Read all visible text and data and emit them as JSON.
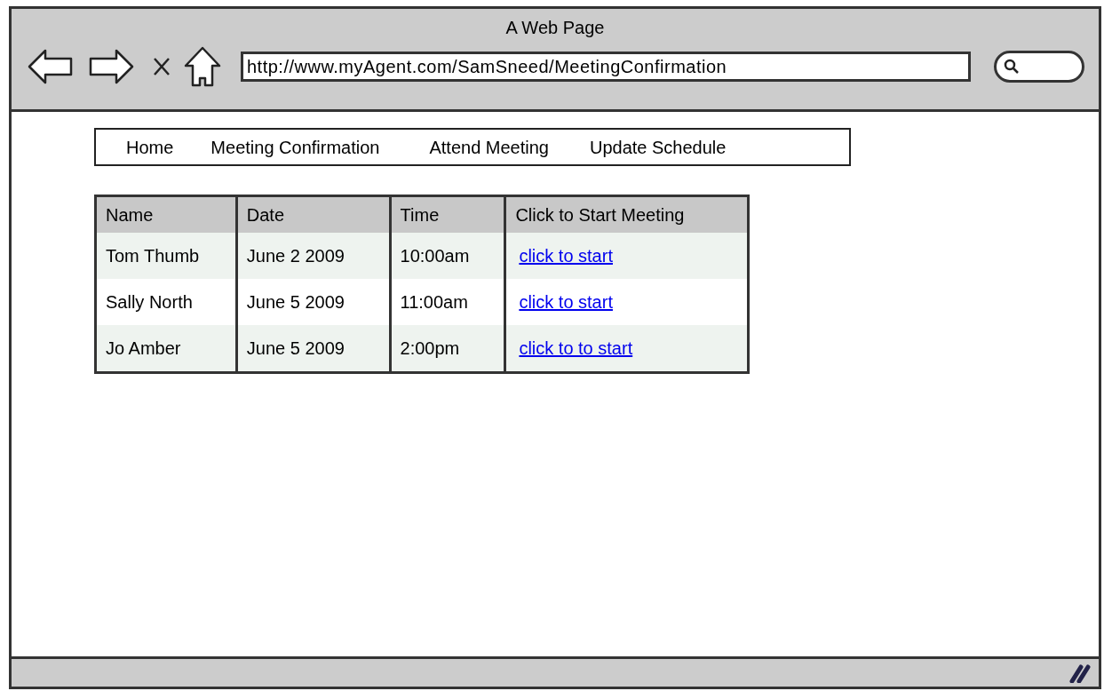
{
  "window": {
    "title": "A Web Page"
  },
  "address_bar": {
    "url": "http://www.myAgent.com/SamSneed/MeetingConfirmation"
  },
  "nav": {
    "items": [
      "Home",
      "Meeting Confirmation",
      "Attend Meeting",
      "Update Schedule"
    ]
  },
  "table": {
    "columns": [
      "Name",
      "Date",
      "Time",
      "Click to Start Meeting"
    ],
    "rows": [
      {
        "name": "Tom Thumb",
        "date": "June 2 2009",
        "time": "10:00am",
        "link": "click to start"
      },
      {
        "name": "Sally North",
        "date": "June 5 2009",
        "time": "11:00am",
        "link": "click to start"
      },
      {
        "name": "Jo Amber",
        "date": "June 5 2009",
        "time": "2:00pm",
        "link": "click to to start"
      }
    ]
  }
}
